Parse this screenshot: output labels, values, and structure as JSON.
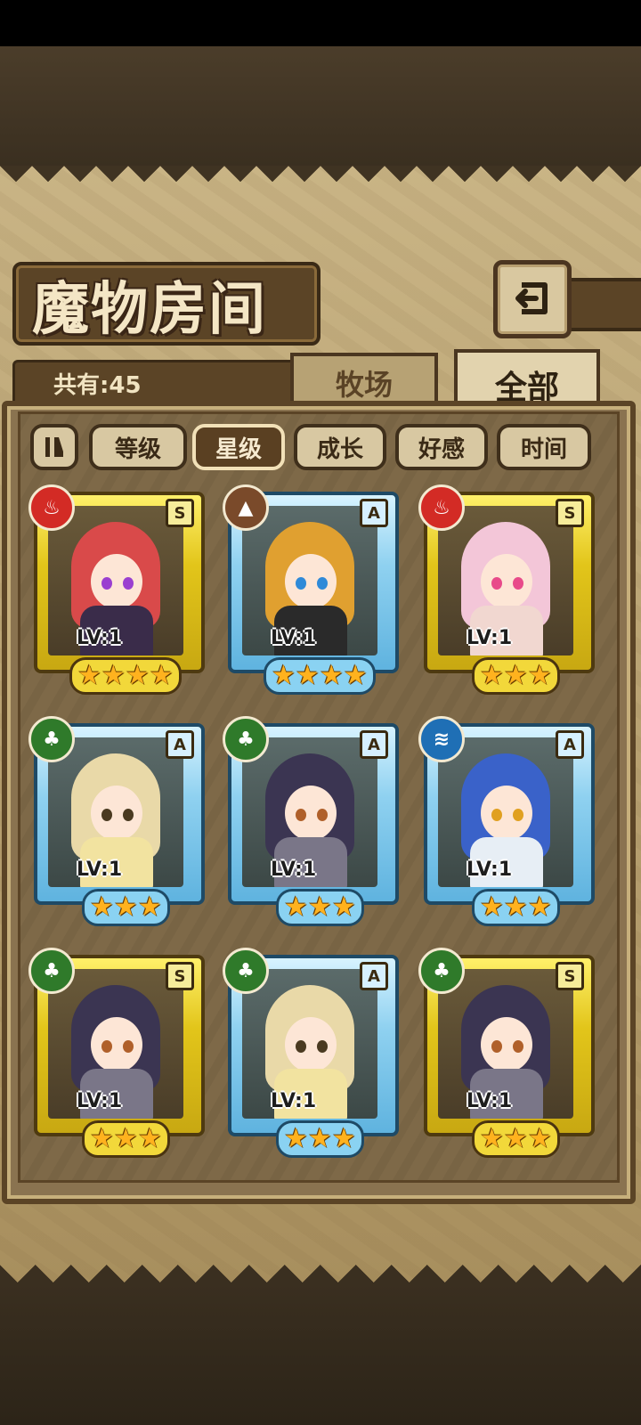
{
  "header": {
    "title": "魔物房间",
    "back_icon": "return-arrow-icon"
  },
  "summary": {
    "count_label": "共有:45"
  },
  "tabs": [
    {
      "label": "牧场",
      "active": false
    },
    {
      "label": "全部",
      "active": true
    }
  ],
  "sort_buttons": [
    {
      "label": "",
      "icon": "sort-toggle-icon",
      "active": false
    },
    {
      "label": "等级",
      "active": false
    },
    {
      "label": "星级",
      "active": true
    },
    {
      "label": "成长",
      "active": false
    },
    {
      "label": "好感",
      "active": false
    },
    {
      "label": "时间",
      "active": false
    }
  ],
  "monsters": [
    {
      "element": "fire",
      "rank": "S",
      "level": "LV:1",
      "stars": 4,
      "frame": "gold"
    },
    {
      "element": "earth",
      "rank": "A",
      "level": "LV:1",
      "stars": 4,
      "frame": "blue"
    },
    {
      "element": "fire",
      "rank": "S",
      "level": "LV:1",
      "stars": 3,
      "frame": "gold"
    },
    {
      "element": "wood",
      "rank": "A",
      "level": "LV:1",
      "stars": 3,
      "frame": "blue"
    },
    {
      "element": "wood",
      "rank": "A",
      "level": "LV:1",
      "stars": 3,
      "frame": "blue"
    },
    {
      "element": "water",
      "rank": "A",
      "level": "LV:1",
      "stars": 3,
      "frame": "blue"
    },
    {
      "element": "wood",
      "rank": "S",
      "level": "LV:1",
      "stars": 3,
      "frame": "gold"
    },
    {
      "element": "wood",
      "rank": "A",
      "level": "LV:1",
      "stars": 3,
      "frame": "blue"
    },
    {
      "element": "wood",
      "rank": "S",
      "level": "LV:1",
      "stars": 3,
      "frame": "gold"
    }
  ],
  "colors": {
    "fire": "#d32b25",
    "earth": "#7a4a2a",
    "wood": "#2f7a2a",
    "water": "#1f6fb5",
    "gold_frame": "#e2c51a",
    "blue_frame": "#8fd1f0"
  }
}
